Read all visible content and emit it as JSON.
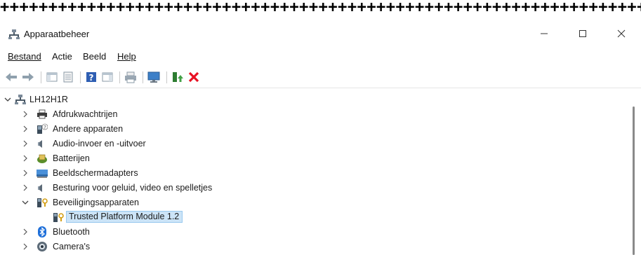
{
  "decor": {
    "border": "++++++++++++++++++++++++++++++++++++++++++++++++++++++++++++++++++++++++"
  },
  "window": {
    "title": "Apparaatbeheer",
    "controls": [
      "minimize",
      "maximize",
      "close"
    ]
  },
  "menu": {
    "items": [
      {
        "label": "Bestand",
        "mnemonic": "B"
      },
      {
        "label": "Actie",
        "mnemonic": "A"
      },
      {
        "label": "Beeld",
        "mnemonic": "d"
      },
      {
        "label": "Help",
        "mnemonic": "H"
      }
    ]
  },
  "toolbar": {
    "buttons": [
      "back-arrow-icon",
      "forward-arrow-icon",
      "show-hide-console-tree-icon",
      "properties-icon",
      "help-icon",
      "action-pane-icon",
      "print-icon",
      "scan-hardware-icon",
      "update-driver-icon",
      "uninstall-device-icon"
    ]
  },
  "tree": {
    "root": {
      "label": "LH12H1R",
      "expanded": true
    },
    "categories": [
      {
        "label": "Afdrukwachtrijen",
        "icon": "printer-icon",
        "expanded": false
      },
      {
        "label": "Andere apparaten",
        "icon": "unknown-device-icon",
        "expanded": false
      },
      {
        "label": "Audio-invoer en -uitvoer",
        "icon": "speaker-icon",
        "expanded": false
      },
      {
        "label": "Batterijen",
        "icon": "battery-icon",
        "expanded": false
      },
      {
        "label": "Beeldschermadapters",
        "icon": "display-adapter-icon",
        "expanded": false
      },
      {
        "label": "Besturing voor geluid, video en spelletjes",
        "icon": "speaker-icon",
        "expanded": false
      },
      {
        "label": "Beveiligingsapparaten",
        "icon": "security-device-icon",
        "expanded": true
      },
      {
        "label": "Bluetooth",
        "icon": "bluetooth-icon",
        "expanded": false
      },
      {
        "label": "Camera's",
        "icon": "camera-icon",
        "expanded": false
      }
    ],
    "selected_child": {
      "label": "Trusted Platform Module 1.2",
      "icon": "security-device-icon"
    }
  },
  "colors": {
    "selection_bg": "#cce4f7",
    "selection_border": "#99c9ef",
    "delete_red": "#e81123",
    "bluetooth_blue": "#1e6fd9"
  }
}
